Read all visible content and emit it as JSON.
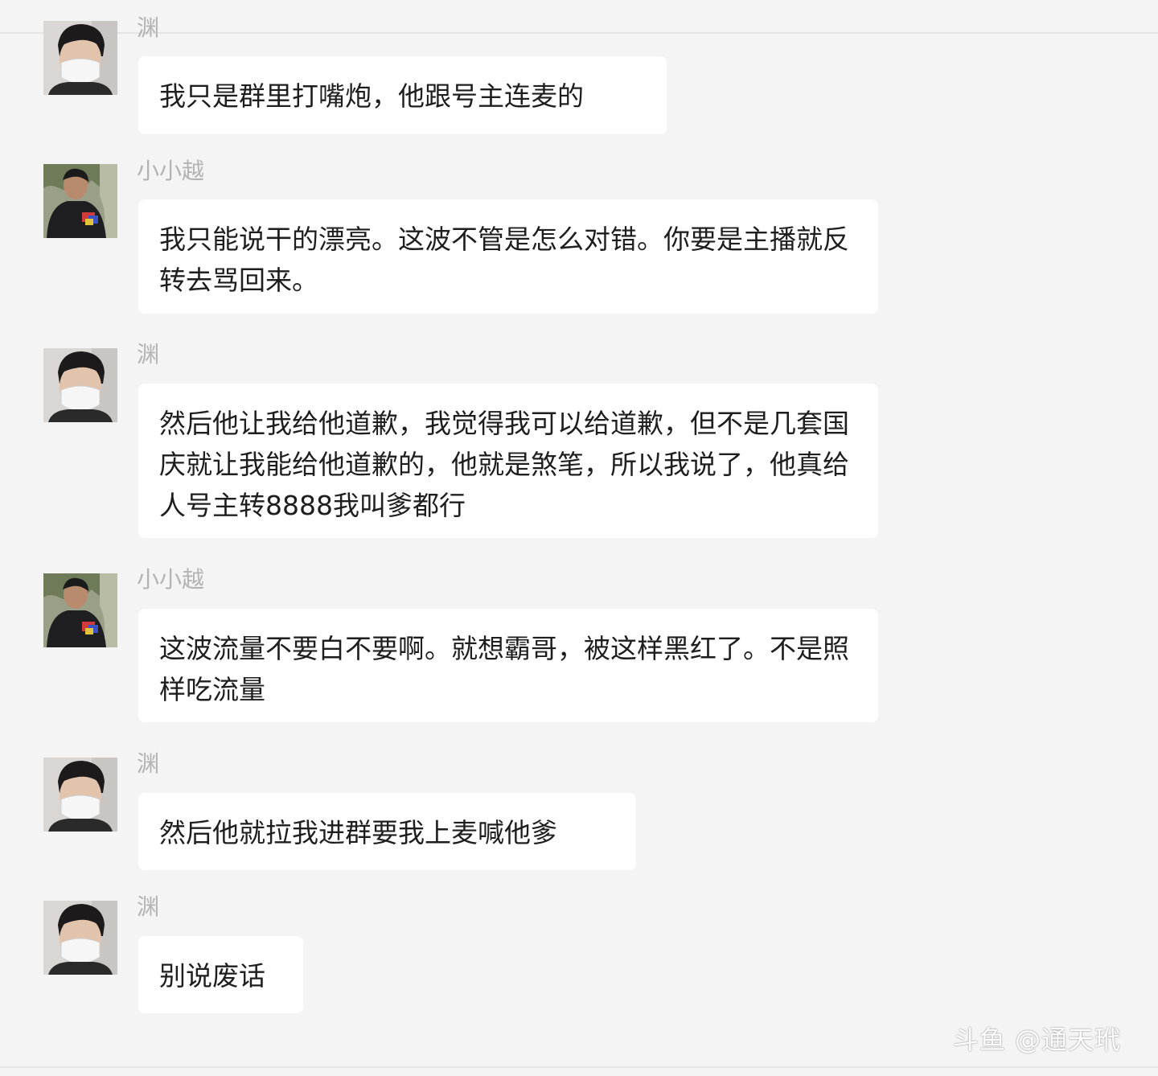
{
  "messages": [
    {
      "sender": "渊",
      "avatar": "masked-person-avatar",
      "text": "我只是群里打嘴炮，他跟号主连麦的"
    },
    {
      "sender": "小小越",
      "avatar": "person-with-phone-avatar",
      "text": "我只能说干的漂亮。这波不管是怎么对错。你要是主播就反转去骂回来。"
    },
    {
      "sender": "渊",
      "avatar": "masked-person-avatar",
      "text": "然后他让我给他道歉，我觉得我可以给道歉，但不是几套国庆就让我能给他道歉的，他就是煞笔，所以我说了，他真给人号主转8888我叫爹都行"
    },
    {
      "sender": "小小越",
      "avatar": "person-with-phone-avatar",
      "text": "这波流量不要白不要啊。就想霸哥，被这样黑红了。不是照样吃流量"
    },
    {
      "sender": "渊",
      "avatar": "masked-person-avatar",
      "text": "然后他就拉我进群要我上麦喊他爹"
    },
    {
      "sender": "渊",
      "avatar": "masked-person-avatar",
      "text": "别说废话"
    }
  ],
  "watermark": "斗鱼 @通天玳",
  "colors": {
    "background": "#f4f4f4",
    "bubble": "#ffffff",
    "sender_text": "#b3b3b3",
    "message_text": "#1e1e1e"
  }
}
